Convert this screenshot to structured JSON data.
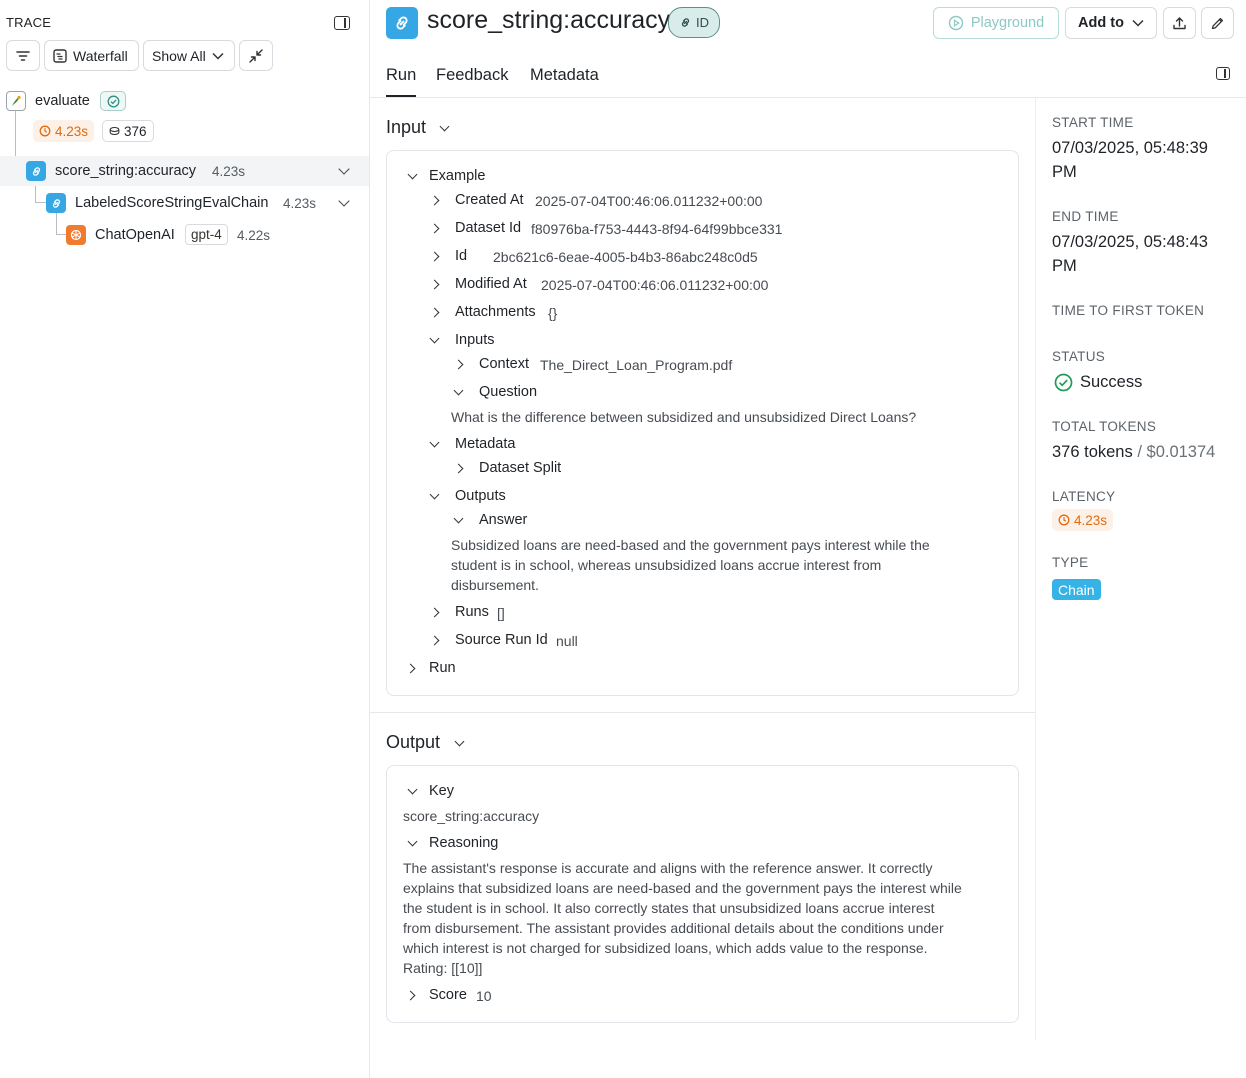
{
  "trace": {
    "title": "TRACE",
    "toolbar": {
      "waterfall": "Waterfall",
      "show_all": "Show All"
    },
    "nodes": [
      {
        "name": "evaluate",
        "latency": "4.23s",
        "tokens": "376",
        "icon": "parrot-icon"
      },
      {
        "name": "score_string:accuracy",
        "latency": "4.23s",
        "icon": "link-icon"
      },
      {
        "name": "LabeledScoreStringEvalChain",
        "latency": "4.23s",
        "icon": "link-icon"
      },
      {
        "name": "ChatOpenAI",
        "model": "gpt-4",
        "latency": "4.22s",
        "icon": "openai-icon"
      }
    ]
  },
  "header": {
    "title": "score_string:accuracy",
    "id_label": "ID",
    "playground": "Playground",
    "add_to": "Add to",
    "tabs": [
      "Run",
      "Feedback",
      "Metadata"
    ]
  },
  "input": {
    "section_title": "Input",
    "example_label": "Example",
    "created_at": {
      "key": "Created At",
      "value": "2025-07-04T00:46:06.011232+00:00"
    },
    "dataset_id": {
      "key": "Dataset Id",
      "value": "f80976ba-f753-4443-8f94-64f99bbce331"
    },
    "id": {
      "key": "Id",
      "value": "2bc621c6-6eae-4005-b4b3-86abc248c0d5"
    },
    "modified_at": {
      "key": "Modified At",
      "value": "2025-07-04T00:46:06.011232+00:00"
    },
    "attachments": {
      "key": "Attachments",
      "value": "{}"
    },
    "inputs_label": "Inputs",
    "context": {
      "key": "Context",
      "value": "The_Direct_Loan_Program.pdf"
    },
    "question": {
      "key": "Question",
      "value": "What is the difference between subsidized and unsubsidized Direct Loans?"
    },
    "metadata_label": "Metadata",
    "dataset_split_label": "Dataset Split",
    "outputs_label": "Outputs",
    "answer": {
      "key": "Answer",
      "lines": [
        "Subsidized loans are need-based and the government pays interest while the",
        "student is in school, whereas unsubsidized loans accrue interest from",
        "disbursement."
      ]
    },
    "runs": {
      "key": "Runs",
      "value": "[]"
    },
    "source_run_id": {
      "key": "Source Run Id",
      "value": "null"
    },
    "run_label": "Run"
  },
  "output": {
    "section_title": "Output",
    "key_label": "Key",
    "key_value": "score_string:accuracy",
    "reasoning_label": "Reasoning",
    "reasoning_lines": [
      "The assistant's response is accurate and aligns with the reference answer. It correctly",
      "explains that subsidized loans are need-based and the government pays the interest while",
      "the student is in school. It also correctly states that unsubsidized loans accrue interest",
      "from disbursement. The assistant provides additional details about the conditions under",
      "which interest is not charged for subsidized loans, which adds value to the response.",
      "Rating: [[10]]"
    ],
    "score_label": "Score",
    "score_value": "10"
  },
  "details": {
    "start_time": {
      "label": "START TIME",
      "line1": "07/03/2025, 05:48:39",
      "line2": "PM"
    },
    "end_time": {
      "label": "END TIME",
      "line1": "07/03/2025, 05:48:43",
      "line2": "PM"
    },
    "ttft_label": "TIME TO FIRST TOKEN",
    "status": {
      "label": "STATUS",
      "value": "Success"
    },
    "total_tokens": {
      "label": "TOTAL TOKENS",
      "tokens": "376 tokens",
      "separator": "/",
      "cost": "$0.01374"
    },
    "latency": {
      "label": "LATENCY",
      "value": "4.23s"
    },
    "type": {
      "label": "TYPE",
      "value": "Chain"
    }
  },
  "colors": {
    "accent_blue": "#35a7e4",
    "latency_orange": "#e06b10",
    "success_green": "#1f9d55",
    "teal": "#5e8f8d"
  }
}
